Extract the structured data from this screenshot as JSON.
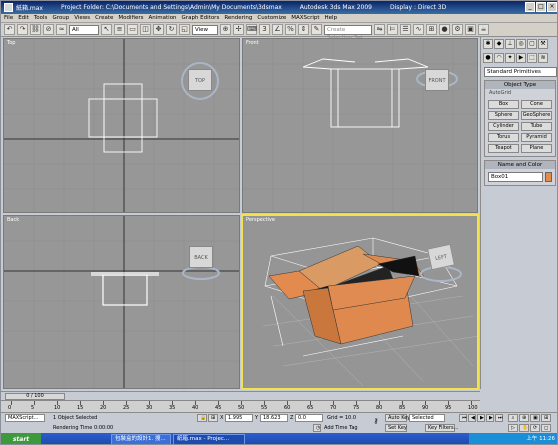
{
  "window": {
    "title_parts": [
      "紙箱.max",
      "Project Folder: C:\\Documents and Settings\\Admin\\My Documents\\3dsmax",
      "Autodesk 3ds Max 2009",
      "Display : Direct 3D"
    ],
    "controls": [
      "_",
      "□",
      "×"
    ]
  },
  "menu": [
    "File",
    "Edit",
    "Tools",
    "Group",
    "Views",
    "Create",
    "Modifiers",
    "Animation",
    "Graph Editors",
    "Rendering",
    "Customize",
    "MAXScript",
    "Help"
  ],
  "toolbar": {
    "selection_filter": "All",
    "reference_coord": "View",
    "named_selection_placeholder": "Create Selection Set"
  },
  "viewports": {
    "top": {
      "label": "Top",
      "cube": "TOP"
    },
    "front": {
      "label": "Front",
      "cube": "FRONT"
    },
    "back": {
      "label": "Back",
      "cube": "BACK"
    },
    "perspective": {
      "label": "Perspective",
      "cube": "LEFT"
    }
  },
  "command_panel": {
    "category": "Standard Primitives",
    "object_type_header": "Object Type",
    "autogrid": "AutoGrid",
    "buttons": [
      "Box",
      "Cone",
      "Sphere",
      "GeoSphere",
      "Cylinder",
      "Tube",
      "Torus",
      "Pyramid",
      "Teapot",
      "Plane"
    ],
    "name_color_header": "Name and Color",
    "object_name": "Box01",
    "object_color": "#e38a4e"
  },
  "timeline": {
    "frame_display": "0 / 100",
    "ticks": [
      "0",
      "5",
      "10",
      "15",
      "20",
      "25",
      "30",
      "35",
      "40",
      "45",
      "50",
      "55",
      "60",
      "65",
      "70",
      "75",
      "80",
      "85",
      "90",
      "95",
      "100"
    ]
  },
  "status": {
    "maxscript_listener": "MAXScript...",
    "selection_status": "1 Object Selected",
    "prompt": "Rendering Time 0:00:00",
    "x_label": "X",
    "x_value": "1.995",
    "y_label": "Y",
    "y_value": "18.623",
    "z_label": "Z",
    "z_value": "0.0",
    "grid": "Grid = 10.0",
    "add_time_tag": "Add Time Tag",
    "auto_key": "Auto Key",
    "key_mode": "Selected",
    "set_key": "Set Key",
    "key_filters": "Key Filters..."
  },
  "taskbar": {
    "start": "start",
    "items": [
      "包裝盒的設計1. 搜...",
      "紙箱.max - Projec..."
    ],
    "tray": "上午 11:26"
  }
}
